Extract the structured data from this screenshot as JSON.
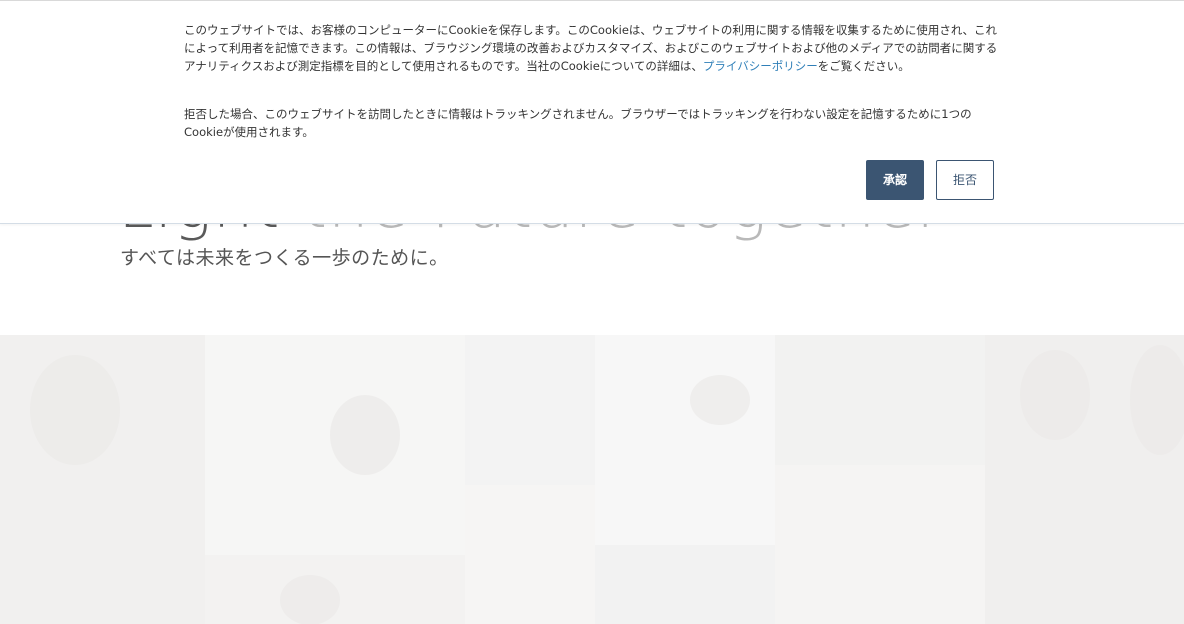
{
  "hero": {
    "title_strong": "Light",
    "title_light": " the Future together",
    "subtitle": "すべては未来をつくる一歩のために。"
  },
  "cookie_banner": {
    "paragraph1_before_link": "このウェブサイトでは、お客様のコンピューターにCookieを保存します。このCookieは、ウェブサイトの利用に関する情報を収集するために使用され、これによって利用者を記憶できます。この情報は、ブラウジング環境の改善およびカスタマイズ、およびこのウェブサイトおよび他のメディアでの訪問者に関するアナリティクスおよび測定指標を目的として使用されるものです。当社のCookieについての詳細は、",
    "privacy_link_text": "プライバシーポリシー",
    "paragraph1_after_link": "をご覧ください。",
    "paragraph2": "拒否した場合、このウェブサイトを訪問したときに情報はトラッキングされません。ブラウザーではトラッキングを行わない設定を記憶するために1つのCookieが使用されます。",
    "accept_label": "承認",
    "decline_label": "拒否"
  },
  "colors": {
    "accent": "#3b5572",
    "link": "#2f7fb8"
  }
}
